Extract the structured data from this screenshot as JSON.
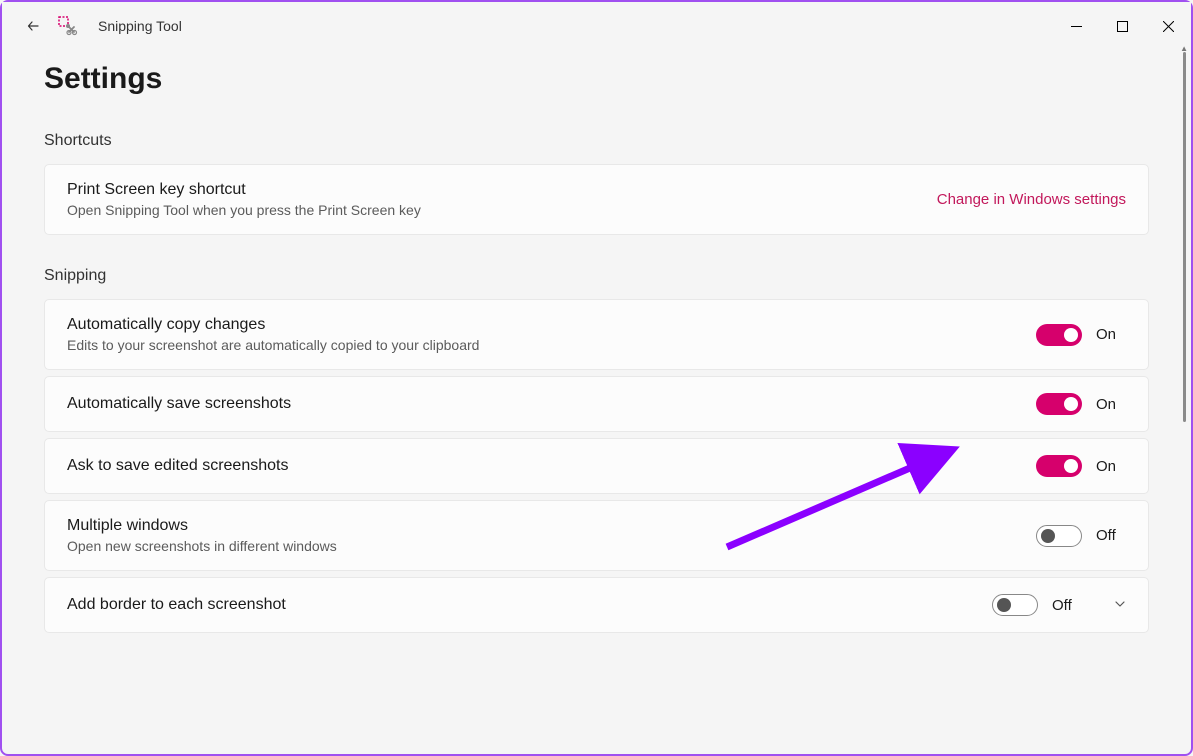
{
  "titlebar": {
    "app_name": "Snipping Tool"
  },
  "page": {
    "title": "Settings"
  },
  "sections": {
    "shortcuts": {
      "label": "Shortcuts",
      "print_screen": {
        "title": "Print Screen key shortcut",
        "subtitle": "Open Snipping Tool when you press the Print Screen key",
        "link": "Change in Windows settings"
      }
    },
    "snipping": {
      "label": "Snipping",
      "auto_copy": {
        "title": "Automatically copy changes",
        "subtitle": "Edits to your screenshot are automatically copied to your clipboard",
        "state": "On"
      },
      "auto_save": {
        "title": "Automatically save screenshots",
        "state": "On"
      },
      "ask_save": {
        "title": "Ask to save edited screenshots",
        "state": "On"
      },
      "multi_windows": {
        "title": "Multiple windows",
        "subtitle": "Open new screenshots in different windows",
        "state": "Off"
      },
      "add_border": {
        "title": "Add border to each screenshot",
        "state": "Off"
      }
    }
  }
}
